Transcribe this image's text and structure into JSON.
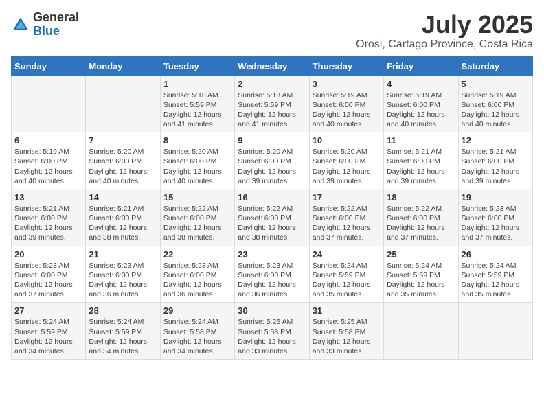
{
  "logo": {
    "general": "General",
    "blue": "Blue"
  },
  "header": {
    "month": "July 2025",
    "location": "Orosi, Cartago Province, Costa Rica"
  },
  "weekdays": [
    "Sunday",
    "Monday",
    "Tuesday",
    "Wednesday",
    "Thursday",
    "Friday",
    "Saturday"
  ],
  "weeks": [
    [
      {
        "day": "",
        "sunrise": "",
        "sunset": "",
        "daylight": ""
      },
      {
        "day": "",
        "sunrise": "",
        "sunset": "",
        "daylight": ""
      },
      {
        "day": "1",
        "sunrise": "Sunrise: 5:18 AM",
        "sunset": "Sunset: 5:59 PM",
        "daylight": "Daylight: 12 hours and 41 minutes."
      },
      {
        "day": "2",
        "sunrise": "Sunrise: 5:18 AM",
        "sunset": "Sunset: 5:59 PM",
        "daylight": "Daylight: 12 hours and 41 minutes."
      },
      {
        "day": "3",
        "sunrise": "Sunrise: 5:19 AM",
        "sunset": "Sunset: 6:00 PM",
        "daylight": "Daylight: 12 hours and 40 minutes."
      },
      {
        "day": "4",
        "sunrise": "Sunrise: 5:19 AM",
        "sunset": "Sunset: 6:00 PM",
        "daylight": "Daylight: 12 hours and 40 minutes."
      },
      {
        "day": "5",
        "sunrise": "Sunrise: 5:19 AM",
        "sunset": "Sunset: 6:00 PM",
        "daylight": "Daylight: 12 hours and 40 minutes."
      }
    ],
    [
      {
        "day": "6",
        "sunrise": "Sunrise: 5:19 AM",
        "sunset": "Sunset: 6:00 PM",
        "daylight": "Daylight: 12 hours and 40 minutes."
      },
      {
        "day": "7",
        "sunrise": "Sunrise: 5:20 AM",
        "sunset": "Sunset: 6:00 PM",
        "daylight": "Daylight: 12 hours and 40 minutes."
      },
      {
        "day": "8",
        "sunrise": "Sunrise: 5:20 AM",
        "sunset": "Sunset: 6:00 PM",
        "daylight": "Daylight: 12 hours and 40 minutes."
      },
      {
        "day": "9",
        "sunrise": "Sunrise: 5:20 AM",
        "sunset": "Sunset: 6:00 PM",
        "daylight": "Daylight: 12 hours and 39 minutes."
      },
      {
        "day": "10",
        "sunrise": "Sunrise: 5:20 AM",
        "sunset": "Sunset: 6:00 PM",
        "daylight": "Daylight: 12 hours and 39 minutes."
      },
      {
        "day": "11",
        "sunrise": "Sunrise: 5:21 AM",
        "sunset": "Sunset: 6:00 PM",
        "daylight": "Daylight: 12 hours and 39 minutes."
      },
      {
        "day": "12",
        "sunrise": "Sunrise: 5:21 AM",
        "sunset": "Sunset: 6:00 PM",
        "daylight": "Daylight: 12 hours and 39 minutes."
      }
    ],
    [
      {
        "day": "13",
        "sunrise": "Sunrise: 5:21 AM",
        "sunset": "Sunset: 6:00 PM",
        "daylight": "Daylight: 12 hours and 39 minutes."
      },
      {
        "day": "14",
        "sunrise": "Sunrise: 5:21 AM",
        "sunset": "Sunset: 6:00 PM",
        "daylight": "Daylight: 12 hours and 38 minutes."
      },
      {
        "day": "15",
        "sunrise": "Sunrise: 5:22 AM",
        "sunset": "Sunset: 6:00 PM",
        "daylight": "Daylight: 12 hours and 38 minutes."
      },
      {
        "day": "16",
        "sunrise": "Sunrise: 5:22 AM",
        "sunset": "Sunset: 6:00 PM",
        "daylight": "Daylight: 12 hours and 38 minutes."
      },
      {
        "day": "17",
        "sunrise": "Sunrise: 5:22 AM",
        "sunset": "Sunset: 6:00 PM",
        "daylight": "Daylight: 12 hours and 37 minutes."
      },
      {
        "day": "18",
        "sunrise": "Sunrise: 5:22 AM",
        "sunset": "Sunset: 6:00 PM",
        "daylight": "Daylight: 12 hours and 37 minutes."
      },
      {
        "day": "19",
        "sunrise": "Sunrise: 5:23 AM",
        "sunset": "Sunset: 6:00 PM",
        "daylight": "Daylight: 12 hours and 37 minutes."
      }
    ],
    [
      {
        "day": "20",
        "sunrise": "Sunrise: 5:23 AM",
        "sunset": "Sunset: 6:00 PM",
        "daylight": "Daylight: 12 hours and 37 minutes."
      },
      {
        "day": "21",
        "sunrise": "Sunrise: 5:23 AM",
        "sunset": "Sunset: 6:00 PM",
        "daylight": "Daylight: 12 hours and 36 minutes."
      },
      {
        "day": "22",
        "sunrise": "Sunrise: 5:23 AM",
        "sunset": "Sunset: 6:00 PM",
        "daylight": "Daylight: 12 hours and 36 minutes."
      },
      {
        "day": "23",
        "sunrise": "Sunrise: 5:23 AM",
        "sunset": "Sunset: 6:00 PM",
        "daylight": "Daylight: 12 hours and 36 minutes."
      },
      {
        "day": "24",
        "sunrise": "Sunrise: 5:24 AM",
        "sunset": "Sunset: 5:59 PM",
        "daylight": "Daylight: 12 hours and 35 minutes."
      },
      {
        "day": "25",
        "sunrise": "Sunrise: 5:24 AM",
        "sunset": "Sunset: 5:59 PM",
        "daylight": "Daylight: 12 hours and 35 minutes."
      },
      {
        "day": "26",
        "sunrise": "Sunrise: 5:24 AM",
        "sunset": "Sunset: 5:59 PM",
        "daylight": "Daylight: 12 hours and 35 minutes."
      }
    ],
    [
      {
        "day": "27",
        "sunrise": "Sunrise: 5:24 AM",
        "sunset": "Sunset: 5:59 PM",
        "daylight": "Daylight: 12 hours and 34 minutes."
      },
      {
        "day": "28",
        "sunrise": "Sunrise: 5:24 AM",
        "sunset": "Sunset: 5:59 PM",
        "daylight": "Daylight: 12 hours and 34 minutes."
      },
      {
        "day": "29",
        "sunrise": "Sunrise: 5:24 AM",
        "sunset": "Sunset: 5:58 PM",
        "daylight": "Daylight: 12 hours and 34 minutes."
      },
      {
        "day": "30",
        "sunrise": "Sunrise: 5:25 AM",
        "sunset": "Sunset: 5:58 PM",
        "daylight": "Daylight: 12 hours and 33 minutes."
      },
      {
        "day": "31",
        "sunrise": "Sunrise: 5:25 AM",
        "sunset": "Sunset: 5:58 PM",
        "daylight": "Daylight: 12 hours and 33 minutes."
      },
      {
        "day": "",
        "sunrise": "",
        "sunset": "",
        "daylight": ""
      },
      {
        "day": "",
        "sunrise": "",
        "sunset": "",
        "daylight": ""
      }
    ]
  ]
}
